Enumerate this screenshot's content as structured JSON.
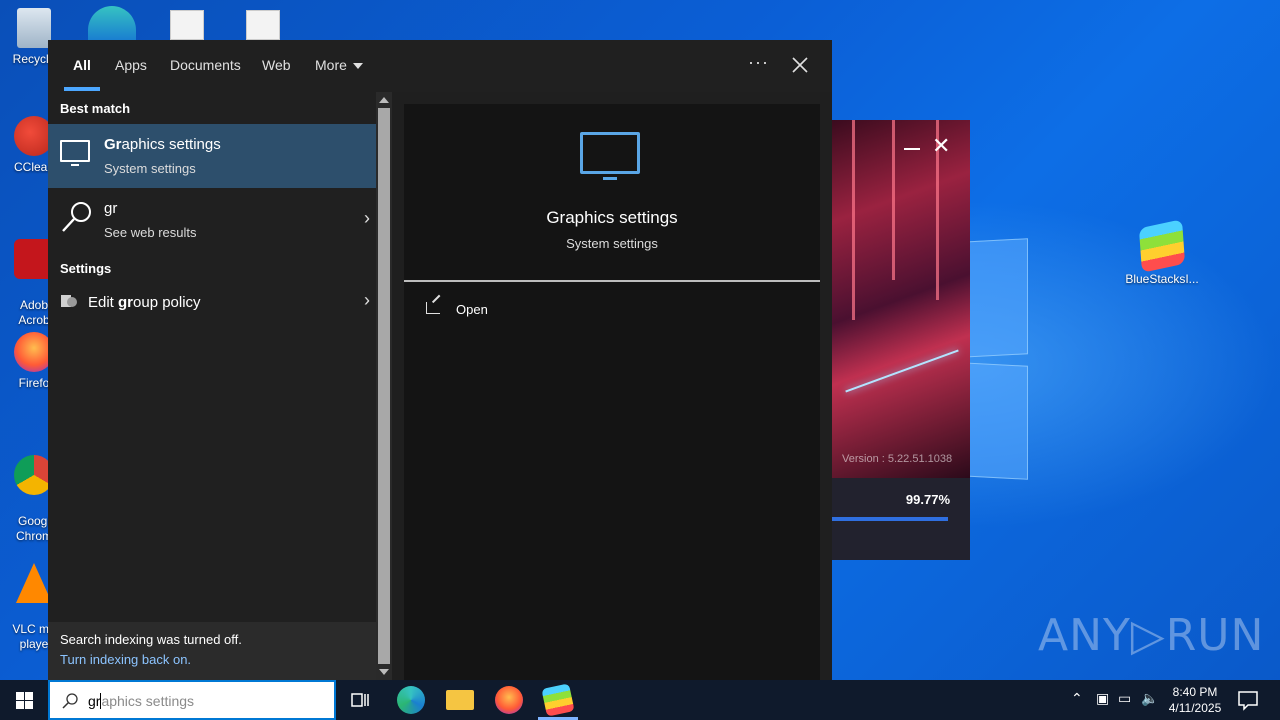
{
  "desktop": {
    "icons": [
      {
        "label": "Recycle"
      },
      {
        "label": "CClean"
      },
      {
        "label": "Adob\nAcrob"
      },
      {
        "label": "Firefo"
      },
      {
        "label": "Googl\nChrom"
      },
      {
        "label": "VLC me\nplaye"
      },
      {
        "label": "BlueStacksI..."
      }
    ],
    "watermark": "ANY▷RUN"
  },
  "bluestacks_splash": {
    "version": "Version : 5.22.51.1038",
    "progress_text": "99.77%",
    "progress_value": 0.9977
  },
  "search": {
    "tabs": [
      {
        "label": "All",
        "active": true
      },
      {
        "label": "Apps"
      },
      {
        "label": "Documents"
      },
      {
        "label": "Web"
      },
      {
        "label": "More"
      }
    ],
    "best_match_heading": "Best match",
    "best_match": {
      "title_bold": "Gr",
      "title_rest": "aphics settings",
      "subtitle": "System settings"
    },
    "web_result": {
      "title": "gr",
      "subtitle": "See web results"
    },
    "settings_heading": "Settings",
    "settings_item": {
      "prefix": "Edit ",
      "bold": "gr",
      "rest": "oup policy"
    },
    "index_notice": "Search indexing was turned off.",
    "index_link": "Turn indexing back on.",
    "preview": {
      "title": "Graphics settings",
      "subtitle": "System settings",
      "open_label": "Open"
    },
    "query_typed": "gr",
    "query_suggestion": "aphics settings"
  },
  "taskbar": {
    "time": "8:40 PM",
    "date": "4/11/2025"
  },
  "colors": {
    "accent": "#4ca7ff",
    "selected_row": "#2d4f6c",
    "desktop_blue": "#0b5fd6"
  }
}
